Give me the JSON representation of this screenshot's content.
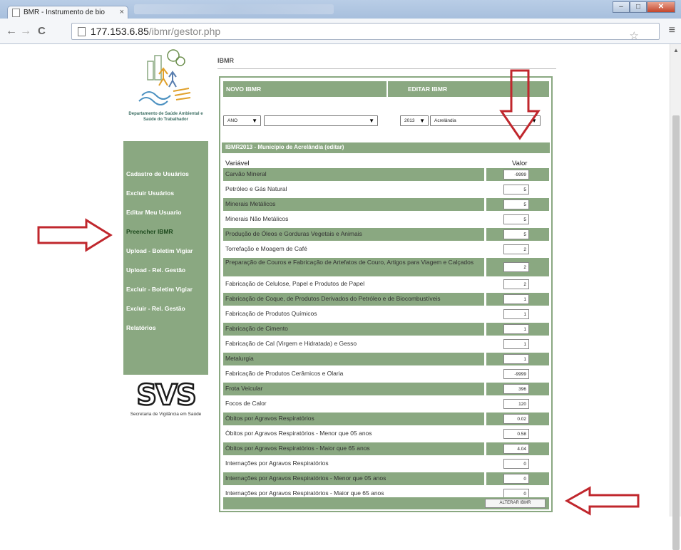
{
  "browser": {
    "tab_title": "BMR - Instrumento de bio",
    "tab_close": "×",
    "url_host": "177.153.6.85",
    "url_path": "/ibmr/gestor.php",
    "back": "←",
    "forward": "→",
    "reload": "C",
    "star": "☆",
    "menu": "≡",
    "win_min": "–",
    "win_max": "□",
    "win_close": "✕"
  },
  "sidebar": {
    "logo_caption": "Departamento de Saúde Ambiental e Saúde do Trabalhador",
    "items": [
      {
        "label": "Cadastro de Usuários"
      },
      {
        "label": "Excluir Usuários"
      },
      {
        "label": "Editar Meu Usuario"
      },
      {
        "label": "Preencher IBMR"
      },
      {
        "label": "Upload - Boletim Vigiar"
      },
      {
        "label": "Upload - Rel. Gestão"
      },
      {
        "label": "Excluir - Boletim Vigiar"
      },
      {
        "label": "Excluir - Rel. Gestão"
      },
      {
        "label": "Relatórios"
      }
    ],
    "svs_text": "SVS",
    "svs_caption": "Secretaria de Vigilância em Saúde"
  },
  "main": {
    "brand": "IBMR",
    "header_left": "NOVO IBMR",
    "header_right": "EDITAR IBMR",
    "select_year_left": "ANO",
    "select_muni_left": "",
    "select_year_right": "2013",
    "select_muni_right": "Acrelândia",
    "form_title": "IBMR2013 - Município de Acrelândia (editar)",
    "col_variable": "Variável",
    "col_value": "Valor",
    "rows": [
      {
        "label": "Carvão Mineral",
        "value": "-9999"
      },
      {
        "label": "Petróleo e Gás Natural",
        "value": "5"
      },
      {
        "label": "Minerais Metálicos",
        "value": "5"
      },
      {
        "label": "Minerais Não Metálicos",
        "value": "5"
      },
      {
        "label": "Produção de Óleos e Gorduras Vegetais e Animais",
        "value": "5"
      },
      {
        "label": "Torrefação e Moagem de Café",
        "value": "2"
      },
      {
        "label": "Preparação de Couros e Fabricação de Artefatos de Couro, Artigos para Viagem e Calçados",
        "value": "2"
      },
      {
        "label": "Fabricação de Celulose, Papel e Produtos de Papel",
        "value": "2"
      },
      {
        "label": "Fabricação de Coque, de Produtos Derivados do Petróleo e de Biocombustíveis",
        "value": "1"
      },
      {
        "label": "Fabricação de Produtos Químicos",
        "value": "1"
      },
      {
        "label": "Fabricação de Cimento",
        "value": "1"
      },
      {
        "label": "Fabricação de Cal (Virgem e Hidratada) e Gesso",
        "value": "1"
      },
      {
        "label": "Metalurgia",
        "value": "1"
      },
      {
        "label": "Fabricação de Produtos Cerâmicos e Olaria",
        "value": "-9999"
      },
      {
        "label": "Frota Veicular",
        "value": "396"
      },
      {
        "label": "Focos de Calor",
        "value": "120"
      },
      {
        "label": "Óbitos por Agravos Respiratórios",
        "value": "0.02"
      },
      {
        "label": "Óbitos por Agravos Respiratórios - Menor que 05 anos",
        "value": "0.58"
      },
      {
        "label": "Óbitos por Agravos Respiratórios - Maior que 65 anos",
        "value": "4.04"
      },
      {
        "label": "Internações por Agravos Respiratórios",
        "value": "0"
      },
      {
        "label": "Internações por Agravos Respiratórios - Menor que 05 anos",
        "value": "0"
      },
      {
        "label": "Internações por Agravos Respiratórios - Maior que 65 anos",
        "value": "0"
      }
    ],
    "submit_label": "ALTERAR IBMR"
  },
  "colors": {
    "accent_green": "#8aa881",
    "arrow_red": "#c0272d"
  }
}
